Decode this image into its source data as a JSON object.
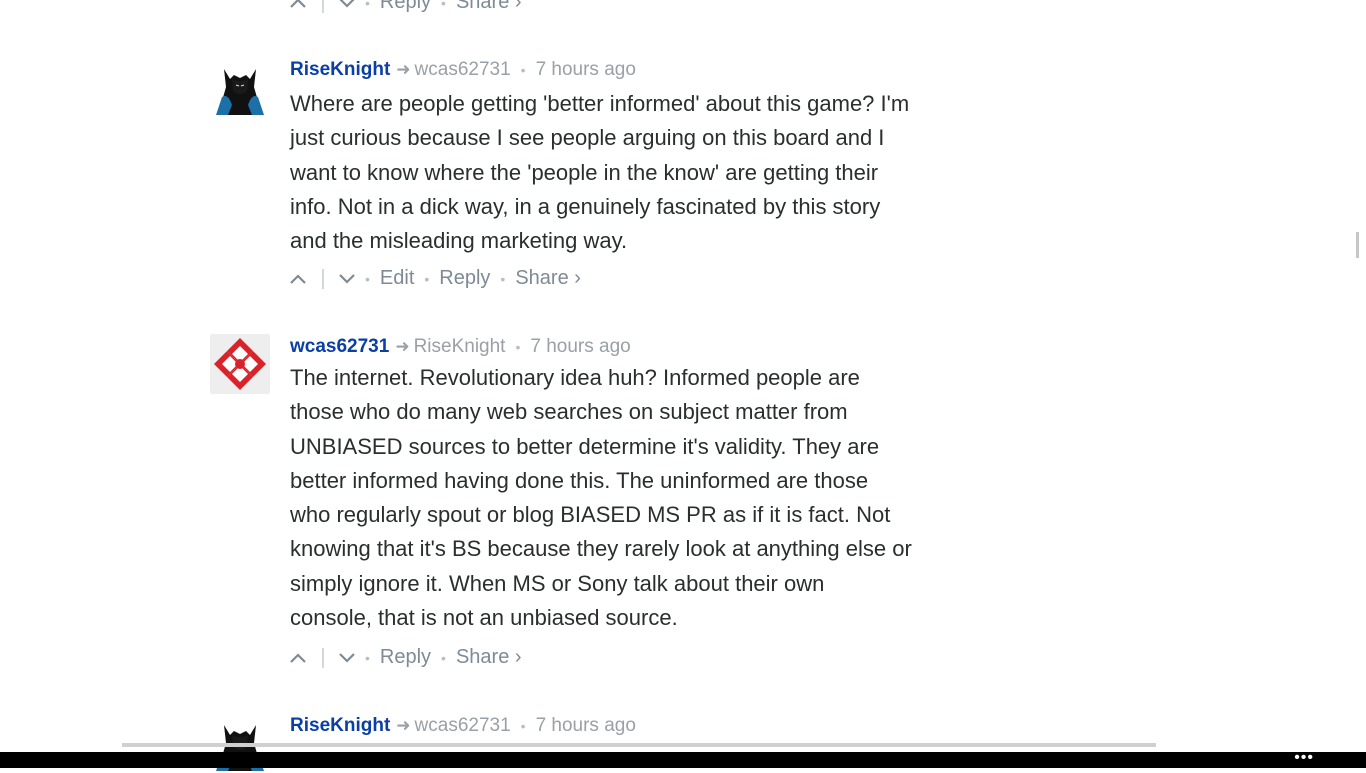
{
  "top_actions": {
    "reply": "Reply",
    "share": "Share ›"
  },
  "comments": [
    {
      "author": "RiseKnight",
      "reply_to": "wcas62731",
      "time": "7 hours ago",
      "avatar": "batman-avatar-icon",
      "lines": [
        "Where are people getting 'better informed' about this game? I'm",
        "just curious because I see people arguing on this board and I",
        "want to know where the 'people in the know' are getting their",
        "info. Not in a dick way, in a genuinely fascinated by this story",
        "and the misleading marketing way."
      ],
      "edit": "Edit",
      "reply": "Reply",
      "share": "Share ›"
    },
    {
      "author": "wcas62731",
      "reply_to": "RiseKnight",
      "time": "7 hours ago",
      "avatar": "ign-logo-avatar-icon",
      "lines": [
        "The internet. Revolutionary idea huh? Informed people are",
        "those who do many web searches on subject matter from",
        "UNBIASED sources to better determine it's validity. They are",
        "better informed having done this. The uninformed are those",
        "who regularly spout or blog BIASED MS PR as if it is fact. Not",
        "knowing that it's BS because they rarely look at anything else or",
        "simply ignore it. When MS or Sony talk about their own",
        "console, that is not an unbiased source."
      ],
      "reply": "Reply",
      "share": "Share ›"
    },
    {
      "author": "RiseKnight",
      "reply_to": "wcas62731",
      "time": "7 hours ago",
      "avatar": "batman-avatar-icon"
    }
  ],
  "taskbar": {
    "more": "•••"
  },
  "colors": {
    "author": "#0a3fa5",
    "meta": "#9aa0a6",
    "text": "#2a2e2e",
    "action": "#7e8a95"
  }
}
